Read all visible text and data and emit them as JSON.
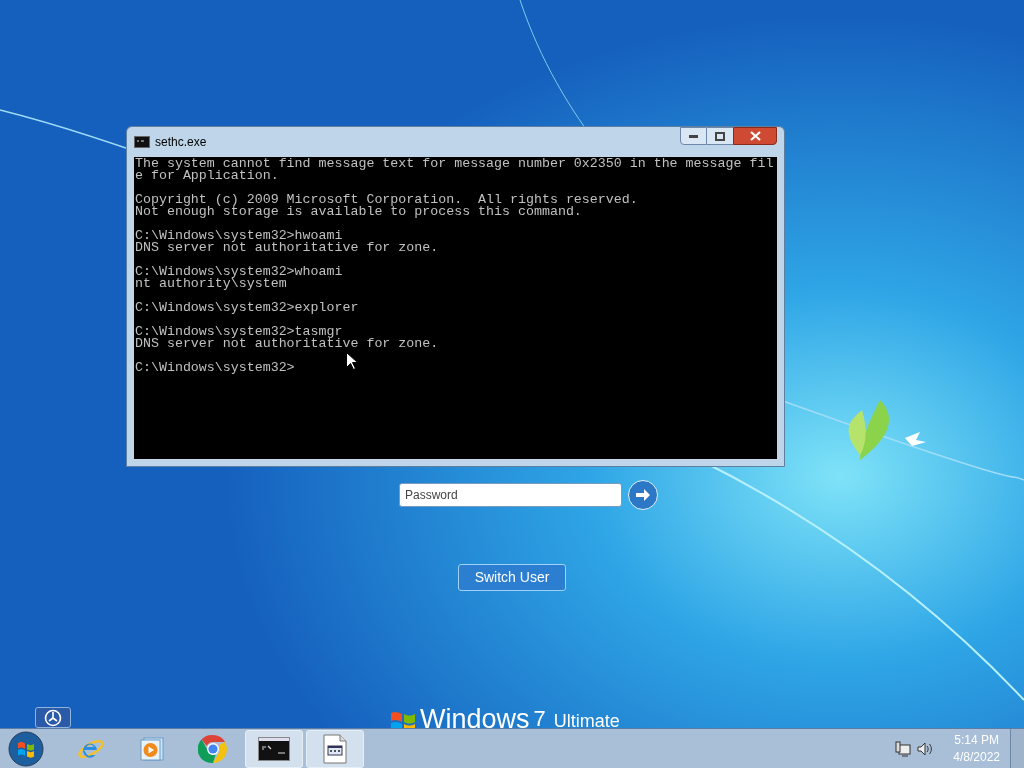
{
  "window": {
    "title": "sethc.exe",
    "console_blocks": [
      [
        "The system cannot find message text for message number 0x2350 in the message fil",
        "e for Application."
      ],
      [
        "Copyright (c) 2009 Microsoft Corporation.  All rights reserved.",
        "Not enough storage is available to process this command."
      ],
      [
        "C:\\Windows\\system32>hwoami",
        "DNS server not authoritative for zone."
      ],
      [
        "C:\\Windows\\system32>whoami",
        "nt authority\\system"
      ],
      [
        "C:\\Windows\\system32>explorer"
      ],
      [
        "C:\\Windows\\system32>tasmgr",
        "DNS server not authoritative for zone."
      ],
      [
        "C:\\Windows\\system32>"
      ]
    ]
  },
  "login": {
    "password": {
      "placeholder": "Password"
    },
    "switch_user": "Switch User"
  },
  "branding": {
    "product": "Windows",
    "version": "7",
    "edition": "Ultimate"
  },
  "taskbar": {
    "items": [
      {
        "kind": "ie",
        "running": false
      },
      {
        "kind": "media",
        "running": false
      },
      {
        "kind": "chrome",
        "running": false
      },
      {
        "kind": "console",
        "running": true
      },
      {
        "kind": "file",
        "running": true
      }
    ],
    "clock": {
      "time": "5:14 PM",
      "date": "4/8/2022"
    }
  }
}
